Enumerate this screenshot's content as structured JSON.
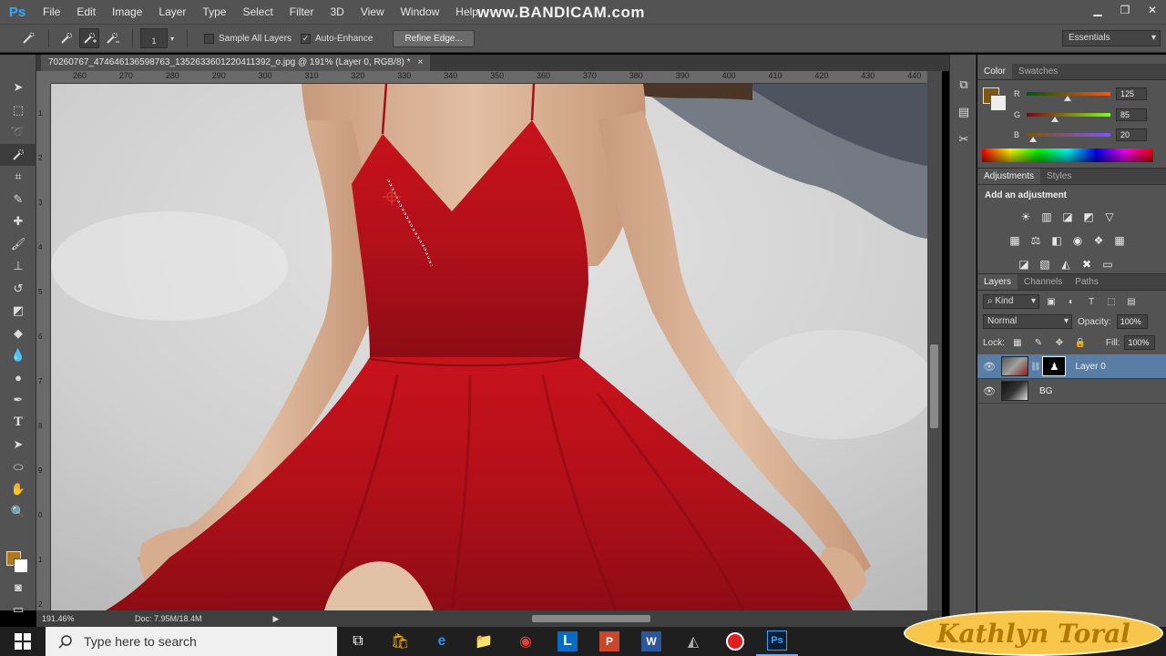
{
  "app": {
    "logo": "Ps",
    "watermark": "www.BANDICAM.com",
    "menu": [
      "File",
      "Edit",
      "Image",
      "Layer",
      "Type",
      "Select",
      "Filter",
      "3D",
      "View",
      "Window",
      "Help"
    ]
  },
  "options_bar": {
    "brush_size": "1",
    "sample_all_layers_label": "Sample All Layers",
    "sample_all_layers_checked": false,
    "auto_enhance_label": "Auto-Enhance",
    "auto_enhance_checked": true,
    "refine_edge_label": "Refine Edge...",
    "workspace": "Essentials"
  },
  "document": {
    "tab_title": "70260767_474646136598763_1352633601220411392_o.jpg @ 191% (Layer 0, RGB/8) *",
    "close": "×",
    "zoom": "191.46%",
    "doc_info": "Doc: 7.95M/18.4M"
  },
  "ruler": {
    "h_ticks": [
      "260",
      "270",
      "280",
      "290",
      "300",
      "310",
      "320",
      "330",
      "340",
      "350",
      "360",
      "370",
      "380",
      "390",
      "400",
      "410",
      "420",
      "430",
      "440"
    ],
    "v_ticks": [
      "1",
      "2",
      "3",
      "4",
      "5",
      "6",
      "7",
      "8",
      "9",
      "0",
      "1",
      "2"
    ]
  },
  "color_panel": {
    "tabs": [
      "Color",
      "Swatches"
    ],
    "r_label": "R",
    "r_value": "125",
    "g_label": "G",
    "g_value": "85",
    "b_label": "B",
    "b_value": "20"
  },
  "adjustments_panel": {
    "tabs": [
      "Adjustments",
      "Styles"
    ],
    "title": "Add an adjustment"
  },
  "layers_panel": {
    "tabs": [
      "Layers",
      "Channels",
      "Paths"
    ],
    "kind_label": "Kind",
    "blend_mode": "Normal",
    "opacity_label": "Opacity:",
    "opacity_value": "100%",
    "lock_label": "Lock:",
    "fill_label": "Fill:",
    "fill_value": "100%",
    "layers": [
      {
        "name": "Layer 0",
        "selected": true
      },
      {
        "name": "BG",
        "selected": false
      }
    ]
  },
  "taskbar": {
    "search_placeholder": "Type here to search"
  },
  "overlay": {
    "signature": "Kathlyn Toral"
  },
  "colors": {
    "foreground": "#b07a1c",
    "color_panel_swatch": "#7d5514",
    "dress": "#b5121b",
    "selected_layer": "#597ea6"
  }
}
